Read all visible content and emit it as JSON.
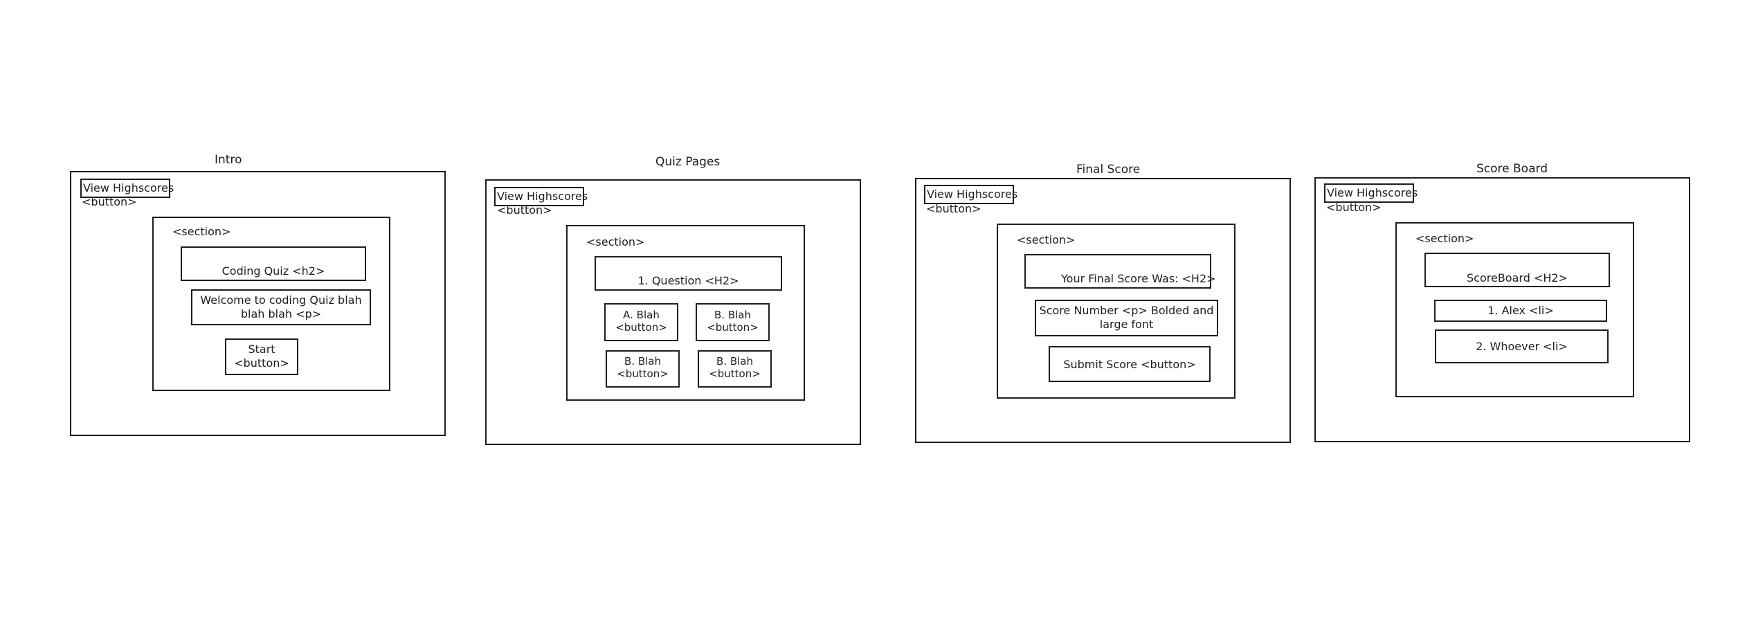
{
  "frames": [
    {
      "title": "Intro",
      "view_highscores_label": "View Highscores",
      "view_highscores_tag": "<button>",
      "section_label": "<section>",
      "heading": "Coding Quiz <h2>",
      "paragraph": "Welcome to coding Quiz blah blah blah <p>",
      "start_button": "Start <button>"
    },
    {
      "title": "Quiz Pages",
      "view_highscores_label": "View Highscores",
      "view_highscores_tag": "<button>",
      "section_label": "<section>",
      "question": "1. Question <H2>",
      "answers": [
        "A. Blah <button>",
        "B. Blah <button>",
        "B. Blah <button>",
        "B. Blah <button>"
      ]
    },
    {
      "title": "Final Score",
      "view_highscores_label": "View Highscores",
      "view_highscores_tag": "<button>",
      "section_label": "<section>",
      "heading": "Your Final Score Was: <H2>",
      "score_text": "Score Number <p> Bolded and large font",
      "submit_button": "Submit Score <button>"
    },
    {
      "title": "Score Board",
      "view_highscores_label": "View Highscores",
      "view_highscores_tag": "<button>",
      "section_label": "<section>",
      "heading": "ScoreBoard <H2>",
      "items": [
        "1. Alex <li>",
        "2. Whoever <li>"
      ]
    }
  ]
}
